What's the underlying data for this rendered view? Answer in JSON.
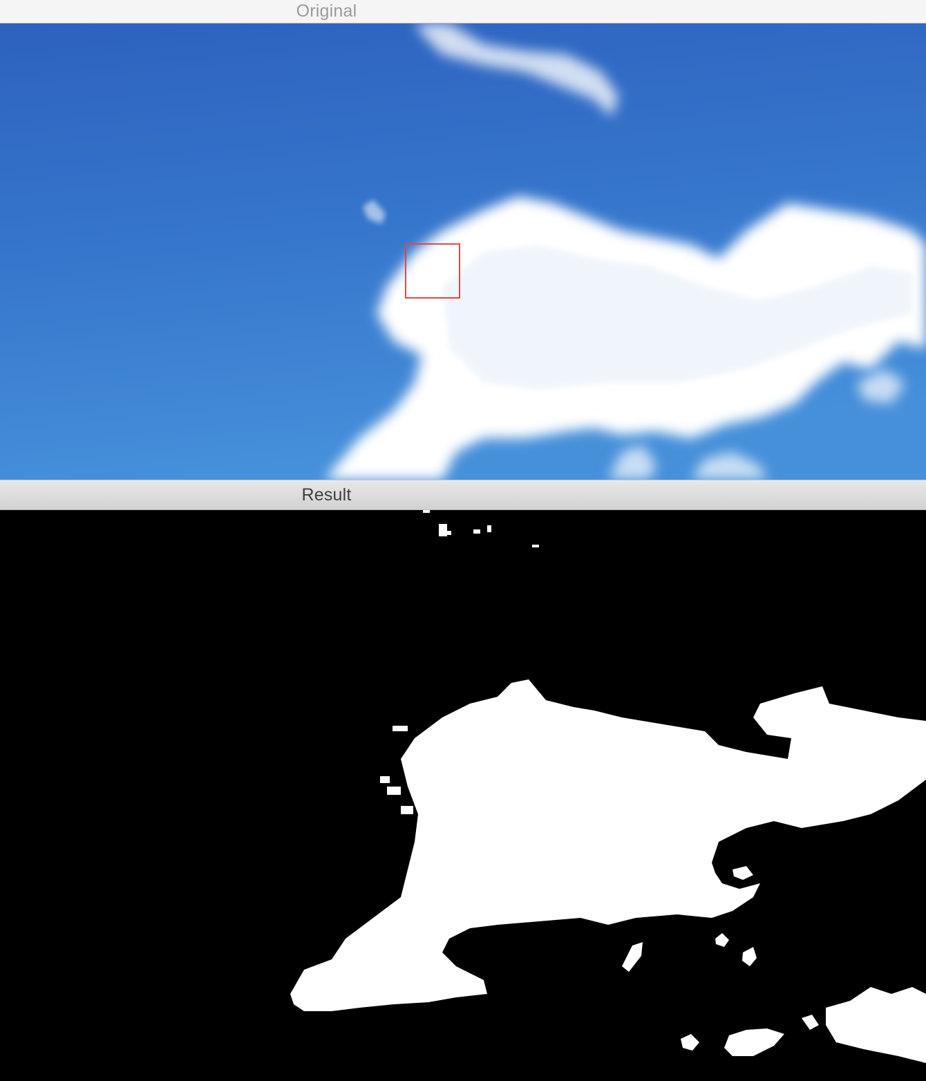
{
  "windows": {
    "original": {
      "title": "Original",
      "sky_top_color": "#2f63c0",
      "sky_bottom_color": "#4489d6",
      "cloud_color": "#ffffff",
      "selection_color": "#e04848"
    },
    "result": {
      "title": "Result",
      "background_color": "#000000",
      "mask_color": "#ffffff"
    }
  }
}
